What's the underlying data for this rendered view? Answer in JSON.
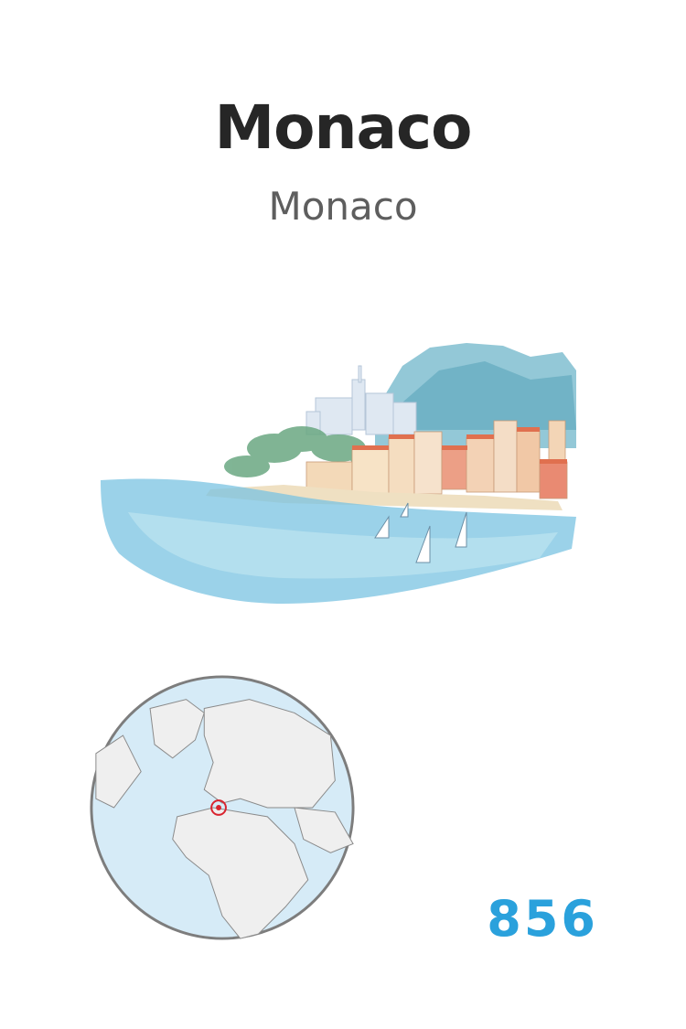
{
  "card": {
    "title": "Monaco",
    "subtitle": "Monaco",
    "number": "856"
  },
  "illustration": {
    "subject": "watercolor-monaco-harbor"
  },
  "locator_map": {
    "highlight_color": "#d9232e",
    "ocean_color": "#d6ebf7",
    "land_color": "#efefef"
  },
  "colors": {
    "title": "#262626",
    "subtitle": "#5e5e5e",
    "number": "#2aa1dc"
  }
}
